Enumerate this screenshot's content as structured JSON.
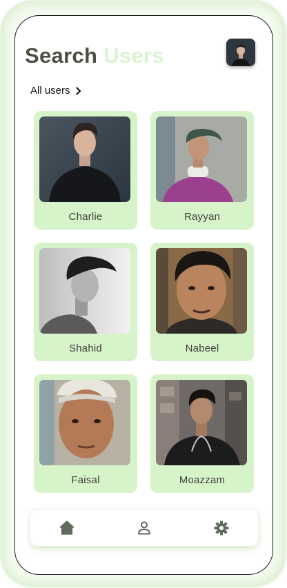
{
  "header": {
    "title_part1": "Search",
    "title_part2": "Users"
  },
  "filter": {
    "label": "All users"
  },
  "users": [
    {
      "name": "Charlie"
    },
    {
      "name": "Rayyan"
    },
    {
      "name": "Shahid"
    },
    {
      "name": "Nabeel"
    },
    {
      "name": "Faisal"
    },
    {
      "name": "Moazzam"
    }
  ],
  "bottom_nav": {
    "items": [
      {
        "icon": "home-icon"
      },
      {
        "icon": "person-icon"
      },
      {
        "icon": "settings-icon"
      }
    ]
  },
  "colors": {
    "accent": "#d8f5cf",
    "card_background": "#d7f3ca",
    "title_dark": "#4a5044",
    "icon_gray": "#5f6b5b"
  }
}
